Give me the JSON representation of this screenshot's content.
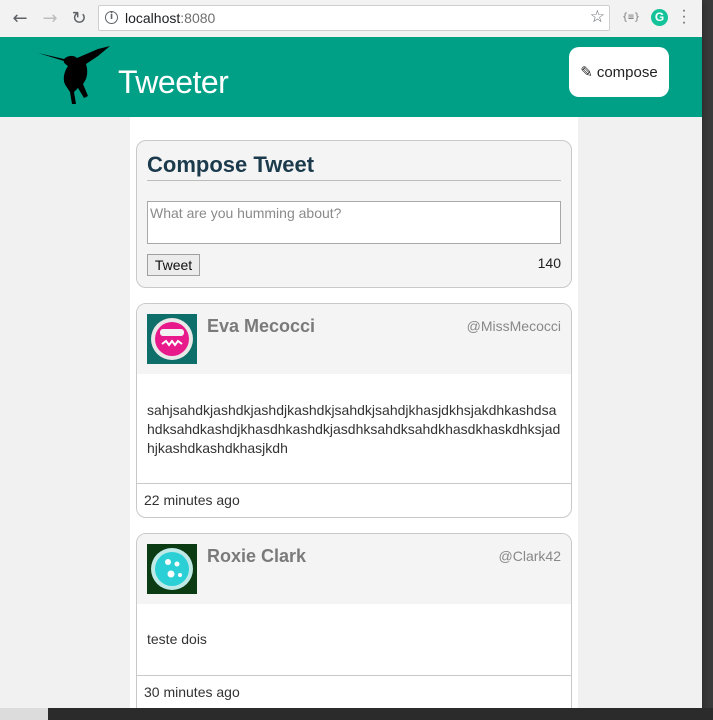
{
  "browser": {
    "url_host": "localhost",
    "url_port": ":8080",
    "ext_json_label": "{≡}",
    "ext_grammarly_label": "G"
  },
  "header": {
    "brand": "Tweeter",
    "compose_label": "compose",
    "color": "#00a087"
  },
  "compose": {
    "title": "Compose Tweet",
    "placeholder": "What are you humming about?",
    "submit_label": "Tweet",
    "counter": "140"
  },
  "tweets": [
    {
      "name": "Eva Mecocci",
      "handle": "@MissMecocci",
      "content": "sahjsahdkjashdkjashdjkashdkjsahdkjsahdjkhasjdkhsjakdhkashdsahdksahdkashdjkhasdhkashdkjasdhksahdksahdkhasdkhaskdhksjadhjkashdkashdkhasjkdh",
      "time": "22 minutes ago"
    },
    {
      "name": "Roxie Clark",
      "handle": "@Clark42",
      "content": "teste dois",
      "time": "30 minutes ago"
    }
  ]
}
